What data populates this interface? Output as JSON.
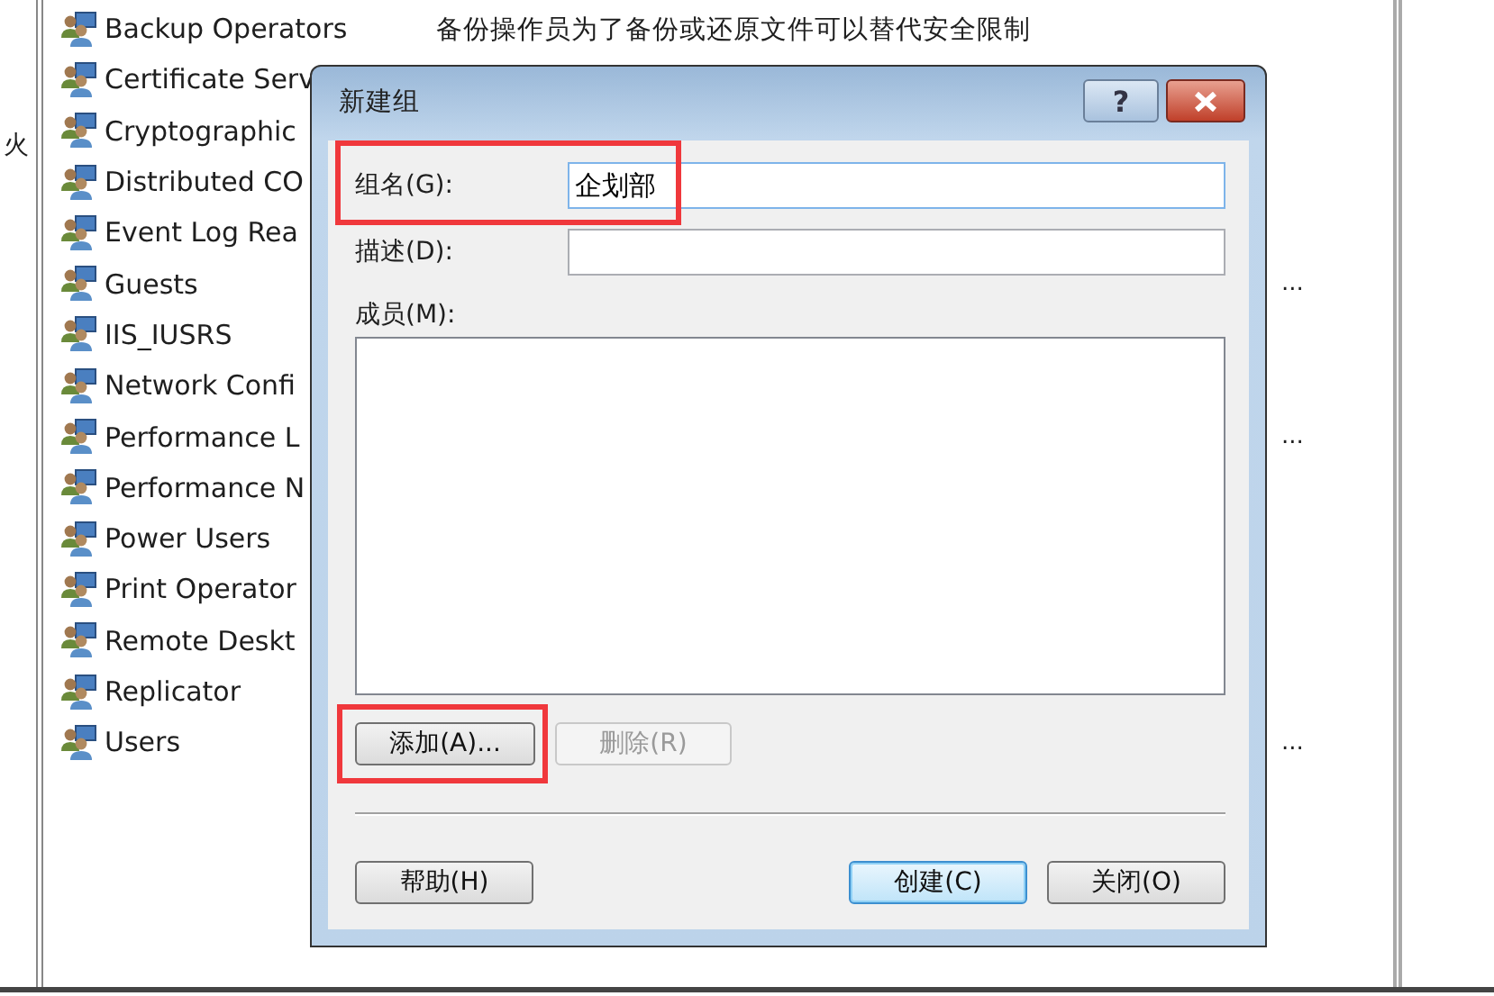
{
  "left_pane": {
    "text": "火"
  },
  "groups": [
    {
      "name": "Backup Operators",
      "description": "备份操作员为了备份或还原文件可以替代安全限制"
    },
    {
      "name": "Certificate Serv"
    },
    {
      "name": "Cryptographic"
    },
    {
      "name": "Distributed CO"
    },
    {
      "name": "Event Log Rea"
    },
    {
      "name": "Guests",
      "description_tail": "..."
    },
    {
      "name": "IIS_IUSRS"
    },
    {
      "name": "Network Confi"
    },
    {
      "name": "Performance L",
      "description_tail": "..."
    },
    {
      "name": "Performance N"
    },
    {
      "name": "Power Users"
    },
    {
      "name": "Print Operator"
    },
    {
      "name": "Remote Deskt"
    },
    {
      "name": "Replicator"
    },
    {
      "name": "Users",
      "description_tail": "..."
    }
  ],
  "dialog": {
    "title": "新建组",
    "help_button": "?",
    "fields": [
      {
        "label": "组名(G):",
        "value": "企划部",
        "highlighted": true
      },
      {
        "label": "描述(D):",
        "highlighted": false
      }
    ],
    "members_label": "成员(M):",
    "member_buttons": [
      {
        "label": "添加(A)...",
        "disabled": false,
        "highlighted": true
      },
      {
        "label": "删除(R)",
        "disabled": true,
        "highlighted": false
      }
    ],
    "buttons": [
      {
        "label": "帮助(H)",
        "default": false
      },
      {
        "label": "创建(C)",
        "default": true
      },
      {
        "label": "关闭(O)",
        "default": false
      }
    ]
  }
}
